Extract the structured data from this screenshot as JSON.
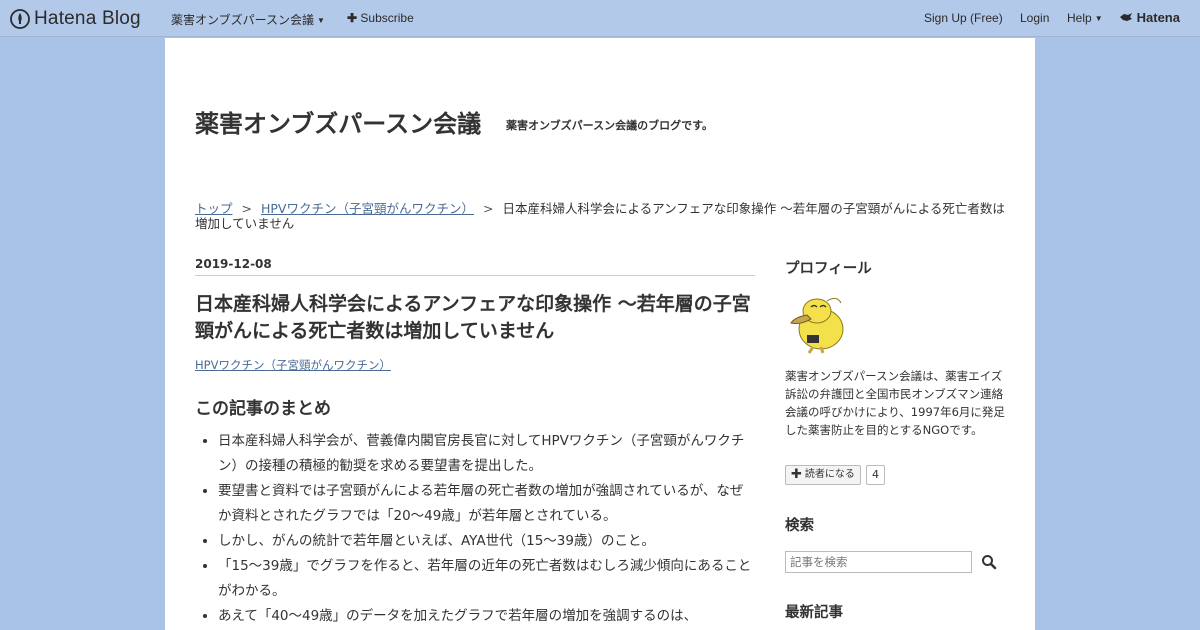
{
  "navbar": {
    "logo_text": "Hatena Blog",
    "blog_name": "薬害オンブズパースン会議",
    "subscribe": "Subscribe",
    "signup": "Sign Up (Free)",
    "login": "Login",
    "help": "Help",
    "hatena": "Hatena"
  },
  "header": {
    "title": "薬害オンブズパースン会議",
    "description": "薬害オンブズパースン会議のブログです。"
  },
  "breadcrumb": {
    "top": "トップ",
    "separator": ">",
    "category": "HPVワクチン（子宮頸がんワクチン）",
    "current": "日本産科婦人科学会によるアンフェアな印象操作 ～若年層の子宮頸がんによる死亡者数は増加していません"
  },
  "entry": {
    "date": "2019-12-08",
    "title": "日本産科婦人科学会によるアンフェアな印象操作 ～若年層の子宮頸がんによる死亡者数は増加していません",
    "category": "HPVワクチン（子宮頸がんワクチン）",
    "summary_heading": "この記事のまとめ",
    "summary_items": [
      "日本産科婦人科学会が、菅義偉内閣官房長官に対してHPVワクチン（子宮頸がんワクチン）の接種の積極的勧奨を求める要望書を提出した。",
      "要望書と資料では子宮頸がんによる若年層の死亡者数の増加が強調されているが、なぜか資料とされたグラフでは「20～49歳」が若年層とされている。",
      "しかし、がんの統計で若年層といえば、AYA世代（15～39歳）のこと。",
      "「15～39歳」でグラフを作ると、若年層の近年の死亡者数はむしろ減少傾向にあることがわかる。",
      "あえて「40～49歳」のデータを加えたグラフで若年層の増加を強調するのは、"
    ]
  },
  "sidebar": {
    "profile_heading": "プロフィール",
    "profile_text": "薬害オンブズパースン会議は、薬害エイズ訴訟の弁護団と全国市民オンブズマン連絡会議の呼びかけにより、1997年6月に発足した薬害防止を目的とするNGOです。",
    "reader_button": "読者になる",
    "reader_count": "4",
    "search_heading": "検索",
    "search_placeholder": "記事を検索",
    "latest_heading": "最新記事"
  }
}
